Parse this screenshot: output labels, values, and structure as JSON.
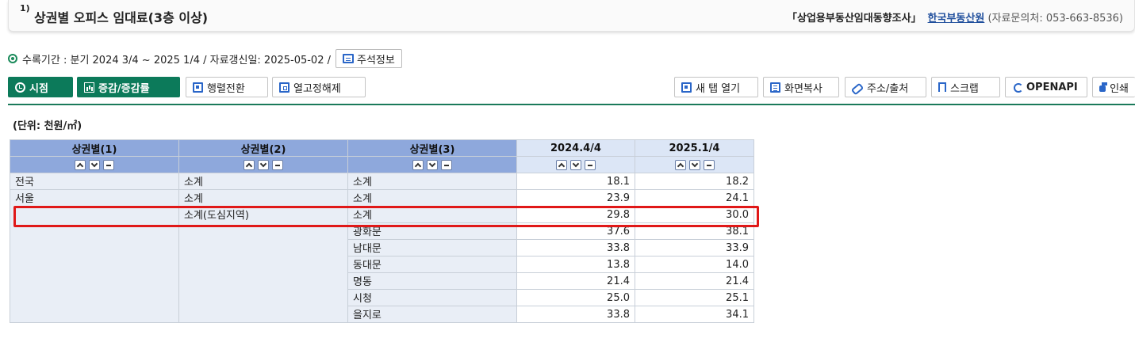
{
  "title": {
    "number": "1)",
    "text": "상권별 오피스 임대료(3층 이상)"
  },
  "source": {
    "name": "「상업용부동산임대동향조사」",
    "org": "한국부동산원",
    "contact": " (자료문의처: 053-663-8536)"
  },
  "info": {
    "text": "수록기간 : 분기 2024 3/4 ~ 2025 1/4 / 자료갱신일: 2025-05-02 /",
    "note_button": "주석정보"
  },
  "toolbar": {
    "time": "시점",
    "change": "증감/증감률",
    "pivot": "행렬전환",
    "unfreeze": "열고정해제",
    "new_tab": "새 탭 열기",
    "copy": "화면복사",
    "address": "주소/출처",
    "scrap": "스크랩",
    "openapi": "OPENAPI",
    "print": "인쇄"
  },
  "unit": "(단위: 천원/㎡)",
  "table": {
    "headers": [
      "상권별(1)",
      "상권별(2)",
      "상권별(3)",
      "2024.4/4",
      "2025.1/4"
    ],
    "rows": [
      [
        "전국",
        "소계",
        "소계",
        "18.1",
        "18.2"
      ],
      [
        "서울",
        "소계",
        "소계",
        "23.9",
        "24.1"
      ],
      [
        "",
        "소계(도심지역)",
        "소계",
        "29.8",
        "30.0"
      ],
      [
        "",
        "",
        "광화문",
        "37.6",
        "38.1"
      ],
      [
        "",
        "",
        "남대문",
        "33.8",
        "33.9"
      ],
      [
        "",
        "",
        "동대문",
        "13.8",
        "14.0"
      ],
      [
        "",
        "",
        "명동",
        "21.4",
        "21.4"
      ],
      [
        "",
        "",
        "시청",
        "25.0",
        "25.1"
      ],
      [
        "",
        "",
        "을지로",
        "33.8",
        "34.1"
      ]
    ]
  },
  "colors": {
    "accent": "#0c7a5a",
    "header_dim": "#8ea8dc",
    "header_period": "#dce6f6",
    "highlight": "#e01818"
  }
}
